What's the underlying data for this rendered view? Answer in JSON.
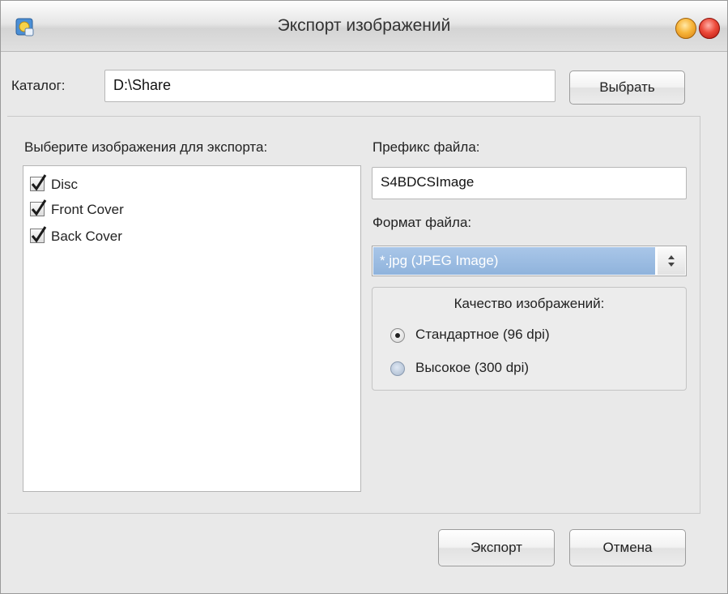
{
  "window": {
    "title": "Экспорт изображений",
    "icons": {
      "app": "app-icon",
      "minimize": "minimize-icon",
      "close": "close-icon"
    }
  },
  "catalog": {
    "label": "Каталог:",
    "value": "D:\\Share",
    "browse_button": "Выбрать"
  },
  "images": {
    "label": "Выберите изображения для экспорта:",
    "items": [
      {
        "label": "Disc",
        "checked": true
      },
      {
        "label": "Front Cover",
        "checked": true
      },
      {
        "label": "Back Cover",
        "checked": true
      }
    ]
  },
  "prefix": {
    "label": "Префикс файла:",
    "value": "S4BDCSImage"
  },
  "format": {
    "label": "Формат файла:",
    "selected": "*.jpg (JPEG Image)"
  },
  "quality": {
    "title": "Качество изображений:",
    "options": [
      {
        "label": "Стандартное (96 dpi)",
        "selected": true
      },
      {
        "label": "Высокое (300 dpi)",
        "selected": false
      }
    ]
  },
  "actions": {
    "export": "Экспорт",
    "cancel": "Отмена"
  },
  "colors": {
    "selection": "#99bbe2",
    "window_bg": "#e9e9e9"
  }
}
